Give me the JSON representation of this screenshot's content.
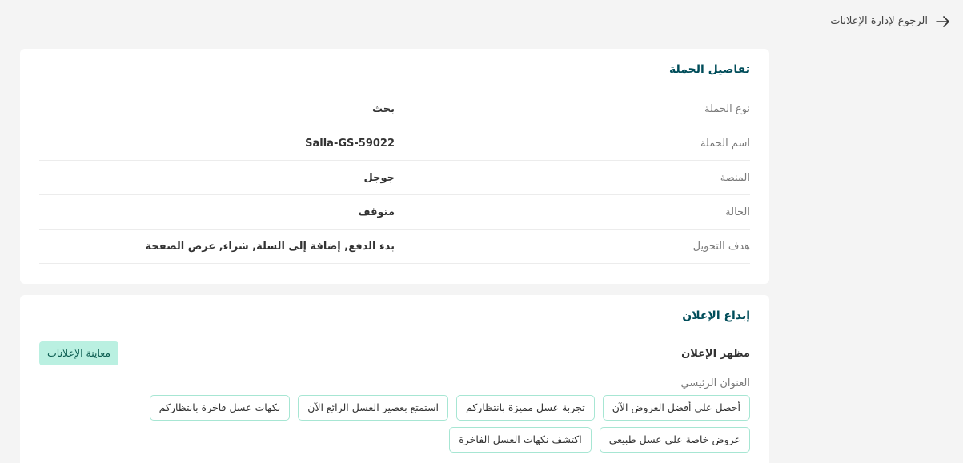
{
  "nav": {
    "back_label": "الرجوع لإدارة الإعلانات"
  },
  "campaign_details": {
    "title": "تفاصيل الحملة",
    "rows": [
      {
        "key": "نوع الحملة",
        "value": "بحث"
      },
      {
        "key": "اسم الحملة",
        "value": "Salla-GS-59022"
      },
      {
        "key": "المنصة",
        "value": "جوجل"
      },
      {
        "key": "الحالة",
        "value": "متوقف"
      },
      {
        "key": "هدف التحويل",
        "value": "بدء الدفع, إضافة إلى السلة, شراء, عرض الصفحة"
      }
    ]
  },
  "ad_creative": {
    "title": "إبداع الإعلان",
    "appearance_label": "مظهر الإعلان",
    "preview_button": "معاينة الإعلانات",
    "headlines_label": "العنوان الرئيسي",
    "headlines": [
      "أحصل على أفضل العروض الآن",
      "تجربة عسل مميزة بانتظاركم",
      "استمتع بعصير العسل الرائع الآن",
      "نكهات عسل فاخرة بانتظاركم",
      "عروض خاصة على عسل طبيعي",
      "اكتشف نكهات العسل الفاخرة"
    ]
  },
  "colors": {
    "accent": "#004d5a",
    "chip_border": "#a7e6d3",
    "button_bg": "#baf0e1",
    "button_text": "#0b5c50"
  }
}
